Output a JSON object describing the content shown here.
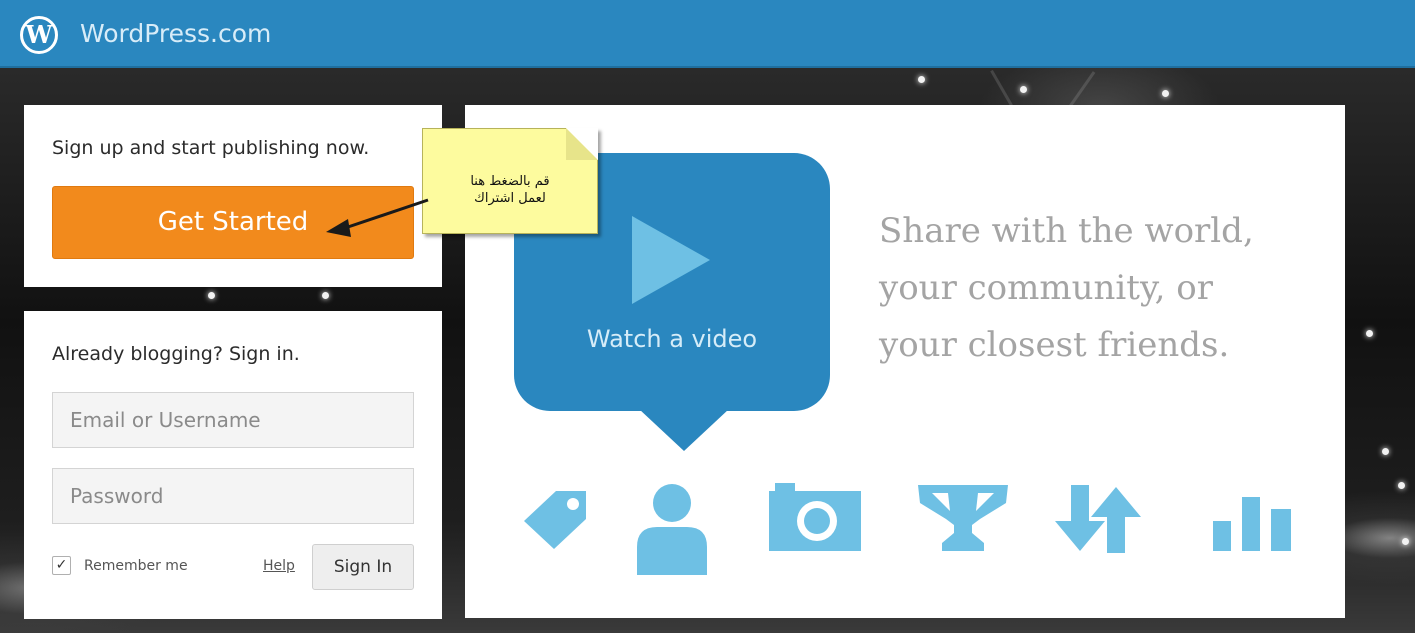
{
  "header": {
    "logo_letter": "W",
    "brand": "WordPress.com"
  },
  "signup": {
    "prompt": "Sign up and start publishing now.",
    "button_label": "Get Started"
  },
  "login": {
    "title": "Already blogging? Sign in.",
    "email_placeholder": "Email or Username",
    "password_placeholder": "Password",
    "remember_checked": true,
    "remember_label": "Remember me",
    "help_label": "Help",
    "signin_label": "Sign In"
  },
  "hero": {
    "watch_label": "Watch a video",
    "share_lines": [
      "Share with the world,",
      "your community, or",
      "your closest friends."
    ]
  },
  "features": {
    "icons": [
      "tag-icon",
      "person-icon",
      "camera-icon",
      "trophy-icon",
      "repost-icon",
      "stats-icon"
    ]
  },
  "annotation": {
    "lines": [
      "قم بالضغط هنا",
      "لعمل اشتراك"
    ]
  },
  "colors": {
    "header_blue": "#2a87bf",
    "orange": "#f28a1c",
    "icon_blue": "#6ec0e4",
    "note_yellow": "#fdfb9e"
  }
}
